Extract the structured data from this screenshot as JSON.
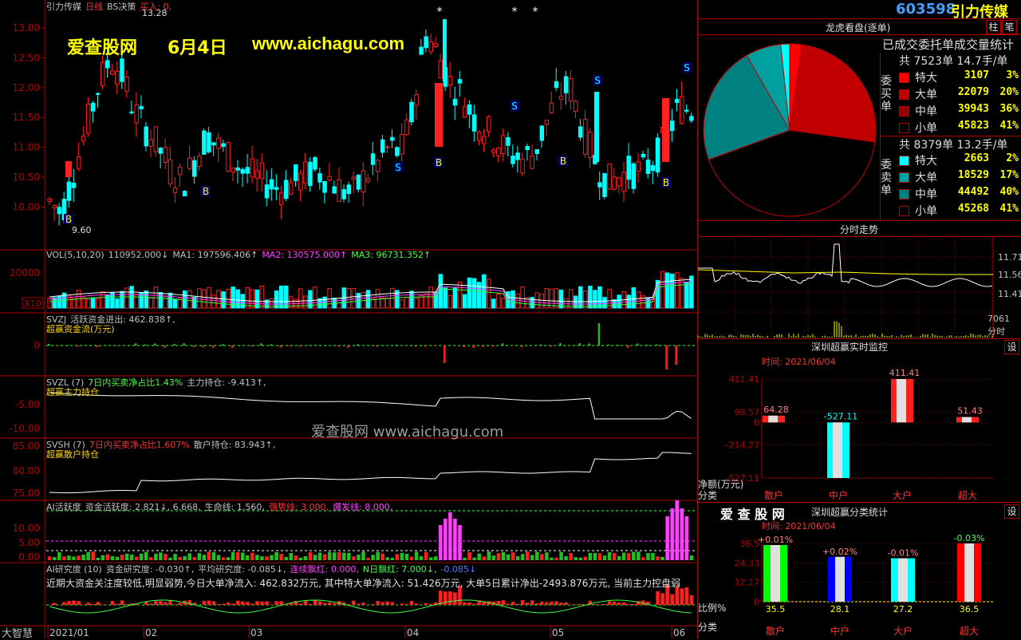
{
  "stock": {
    "code": "603598",
    "name": "引力传媒"
  },
  "main_chart": {
    "header": [
      {
        "text": "引力传媒",
        "color": "#c0c0c0"
      },
      {
        "text": "日线",
        "color": "#ff3030"
      },
      {
        "text": "BS决策",
        "color": "#c0c0c0"
      },
      {
        "text": "买入: 0,",
        "color": "#ff3030"
      }
    ],
    "price_labels": [
      "13.00",
      "12.50",
      "12.00",
      "11.50",
      "11.00",
      "10.50",
      "10.00"
    ],
    "high_marker": "13.28",
    "low_marker": "9.60",
    "watermark_title": "爱查股网",
    "watermark_date": "6月4日",
    "watermark_url": "www.aichagu.com"
  },
  "vol_panel": {
    "header": [
      {
        "text": "VOL(5,10,20)",
        "color": "#c0c0c0"
      },
      {
        "text": "110952.000↓",
        "color": "#c0c0c0"
      },
      {
        "text": "MA1: 197596.406↑",
        "color": "#c0c0c0"
      },
      {
        "text": "MA2: 130575.000↑",
        "color": "#ff40ff"
      },
      {
        "text": "MA3: 96731.352↑",
        "color": "#40ff40"
      }
    ],
    "label": "20000",
    "unit": "X10"
  },
  "svzj_panel": {
    "header": [
      {
        "text": "SVZJ",
        "color": "#c0c0c0"
      },
      {
        "text": "活跃资金进出: 462.838↑,",
        "color": "#c0c0c0"
      }
    ],
    "subtitle": "超赢资金流(万元)",
    "label": "0"
  },
  "svzl_panel": {
    "header": [
      {
        "text": "SVZL (7)",
        "color": "#c0c0c0"
      },
      {
        "text": "7日内买卖净占比1.43%",
        "color": "#40ff40"
      },
      {
        "text": "主力持仓: -9.413↑,",
        "color": "#c0c0c0"
      }
    ],
    "subtitle": "超赢主力持仓",
    "labels": [
      "-5.00",
      "-10.00"
    ],
    "watermark": "爱查股网   www.aichagu.com"
  },
  "svsh_panel": {
    "header": [
      {
        "text": "SVSH (7)",
        "color": "#c0c0c0"
      },
      {
        "text": "7日内买卖净占比1.607%",
        "color": "#ff3030"
      },
      {
        "text": "散户持仓: 83.943↑,",
        "color": "#c0c0c0"
      }
    ],
    "subtitle": "超赢散户持仓",
    "labels": [
      "85.00",
      "80.00",
      "75.00"
    ]
  },
  "ai_active_panel": {
    "header": [
      {
        "text": "AI活跃度",
        "color": "#c0c0c0"
      },
      {
        "text": "资金活跃度: 2.821↓, 6.668,",
        "color": "#c0c0c0"
      },
      {
        "text": "生命线: 1.560,",
        "color": "#c0c0c0"
      },
      {
        "text": "强势线: 3.000,",
        "color": "#ff3030"
      },
      {
        "text": "爆发线: 8.000,",
        "color": "#ff40ff"
      }
    ],
    "labels": [
      "10.00",
      "5.00",
      "0.00"
    ]
  },
  "ai_research_panel": {
    "header": [
      {
        "text": "AI研究度 (10)",
        "color": "#c0c0c0"
      },
      {
        "text": "资金研究度: -0.030↑,",
        "color": "#c0c0c0"
      },
      {
        "text": "平均研究度: -0.085↓,",
        "color": "#c0c0c0"
      },
      {
        "text": "连续飘红: 0.000,",
        "color": "#ff40ff"
      },
      {
        "text": "N日飘红: 7.000↓,",
        "color": "#40ff40"
      },
      {
        "text": "-0.085↓",
        "color": "#4080ff"
      }
    ],
    "comment": "近期大资金关注度较低,明显弱势,今日大单净流入: 462.832万元, 其中特大单净流入: 51.426万元, 大单5日累计净出-2493.876万元, 当前主力控盘弱",
    "brand": "大智慧"
  },
  "x_axis": [
    "2021/01",
    "02",
    "03",
    "04",
    "05",
    "06"
  ],
  "dragon_tiger": {
    "title": "龙虎看盘(逐单)",
    "subtitle": "已成交委托单成交量统计",
    "buy_label": "委买单",
    "sell_label": "委卖单",
    "buy_total": "共 7523单 14.7手/单",
    "sell_total": "共 8379单 13.2手/单",
    "buy_rows": [
      {
        "name": "特大",
        "value": "3107",
        "pct": "3%",
        "color": "#ff0000"
      },
      {
        "name": "大单",
        "value": "22079",
        "pct": "20%",
        "color": "#c00000"
      },
      {
        "name": "中单",
        "value": "39943",
        "pct": "36%",
        "color": "#900000"
      },
      {
        "name": "小单",
        "value": "45823",
        "pct": "41%",
        "color": "#000000"
      }
    ],
    "sell_rows": [
      {
        "name": "特大",
        "value": "2663",
        "pct": "2%",
        "color": "#00ffff"
      },
      {
        "name": "大单",
        "value": "18529",
        "pct": "17%",
        "color": "#00a0a0"
      },
      {
        "name": "中单",
        "value": "44492",
        "pct": "40%",
        "color": "#008080"
      },
      {
        "name": "小单",
        "value": "45268",
        "pct": "41%",
        "color": "#000000"
      }
    ],
    "btn_zhu": "柱",
    "btn_bi": "笔"
  },
  "intraday": {
    "title": "分时走势",
    "labels": [
      "11.71",
      "11.56",
      "11.41"
    ],
    "vol_label": "7061",
    "vol_unit": "分时"
  },
  "monitor": {
    "title": "深圳超赢实时监控",
    "time": "时间: 2021/06/04",
    "btn": "设",
    "y_labels": [
      "411.41",
      "98.57",
      "0",
      "-214.27",
      "-527.11"
    ],
    "y_unit": "净额(万元)",
    "cat_label": "分类",
    "categories": [
      "散户",
      "中户",
      "大户",
      "超大"
    ],
    "values": [
      64.28,
      -527.11,
      411.41,
      51.43
    ],
    "value_labels": [
      "64.28",
      "-527.11",
      "411.41",
      "51.43"
    ]
  },
  "classify": {
    "brand": "爱 查 股 网",
    "title": "深圳超赢分类统计",
    "time": "时间: 2021/06/04",
    "btn": "设",
    "y_labels": [
      "36.5",
      "24.33",
      "12.17",
      "0"
    ],
    "y_unit": "比例%",
    "cat_label": "分类",
    "categories": [
      "散户",
      "中户",
      "大户",
      "超大"
    ],
    "values": [
      35.5,
      28.1,
      27.2,
      36.5
    ],
    "bottom_labels": [
      "35.5",
      "28.1",
      "27.2",
      "36.5"
    ],
    "top_labels": [
      "+0.01%",
      "+0.02%",
      "-0.01%",
      "-0.03%"
    ],
    "bar_colors": [
      "#00ff00",
      "#0000ff",
      "#00ffff",
      "#ff0000"
    ]
  }
}
